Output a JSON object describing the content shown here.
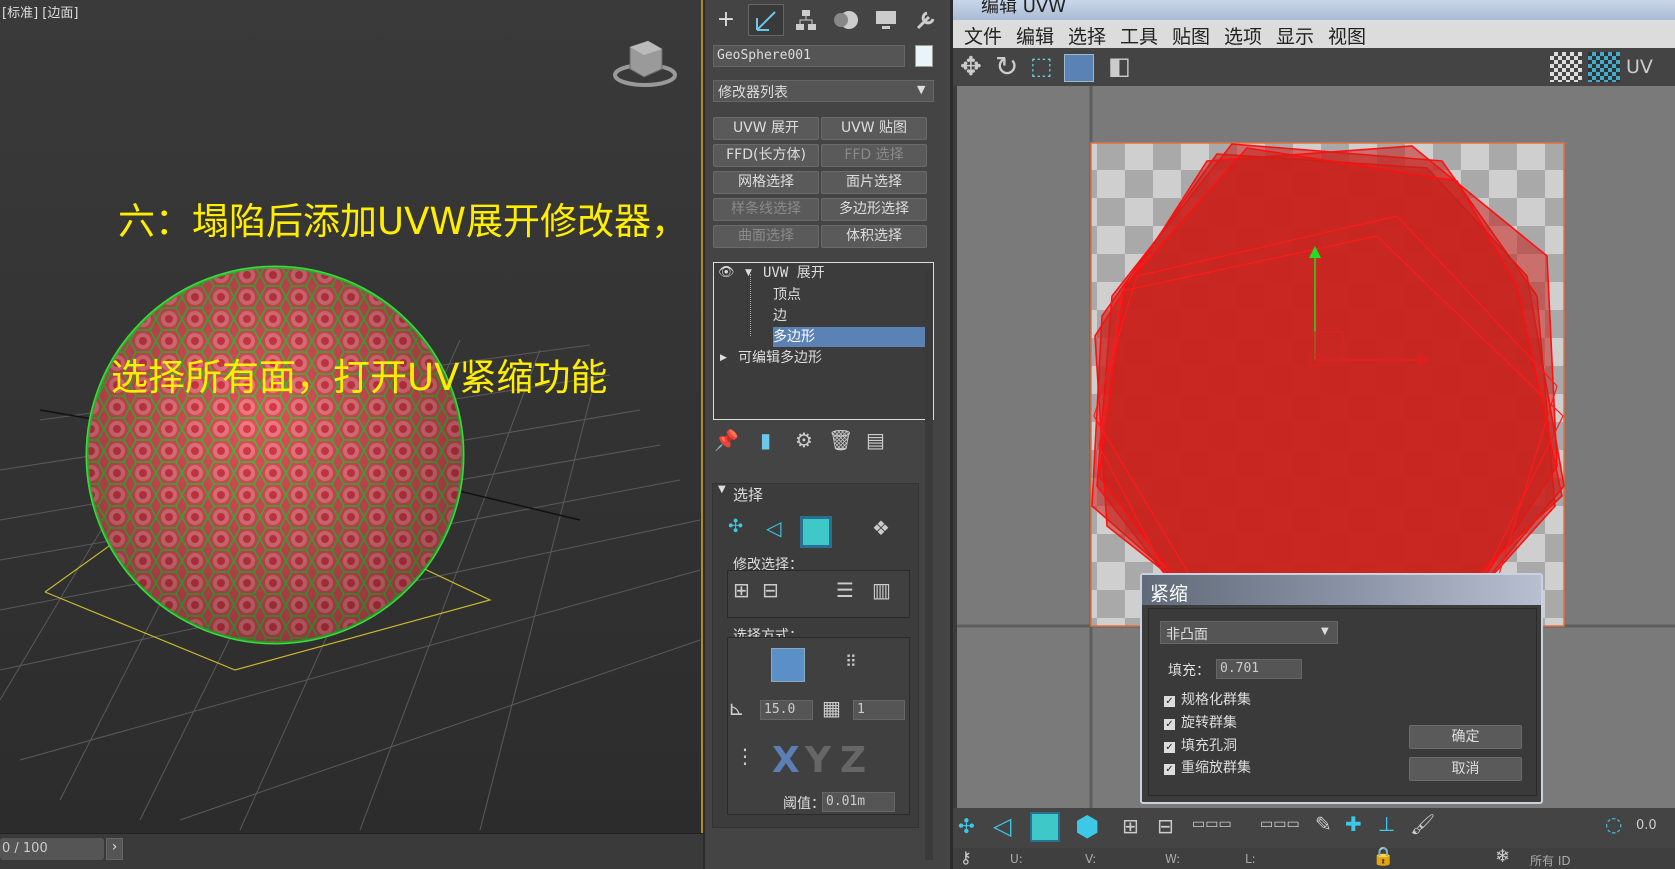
{
  "viewport": {
    "label": "[标准] [边面]",
    "tutorial_line1": "六：塌陷后添加UVW展开修改器，",
    "tutorial_line2": "选择所有面，打开UV紧缩功能",
    "frame": "0 / 100",
    "next_arrow": "›",
    "axis_z": "Z"
  },
  "command_panel": {
    "tabs": [
      "create-icon",
      "modify-icon",
      "hierarchy-icon",
      "motion-icon",
      "display-icon",
      "utilities-icon"
    ],
    "object_name": "GeoSphere001",
    "object_color": "#e8f4f8",
    "modifier_list": "修改器列表",
    "modifier_buttons": [
      {
        "label": "UVW 展开",
        "enabled": true
      },
      {
        "label": "UVW 贴图",
        "enabled": true
      },
      {
        "label": "FFD(长方体)",
        "enabled": true
      },
      {
        "label": "FFD 选择",
        "enabled": false
      },
      {
        "label": "网格选择",
        "enabled": true
      },
      {
        "label": "面片选择",
        "enabled": true
      },
      {
        "label": "样条线选择",
        "enabled": false
      },
      {
        "label": "多边形选择",
        "enabled": true
      },
      {
        "label": "曲面选择",
        "enabled": false
      },
      {
        "label": "体积选择",
        "enabled": true
      }
    ],
    "stack": {
      "top": "UVW 展开",
      "sub_vertex": "顶点",
      "sub_edge": "边",
      "sub_polygon": "多边形",
      "base": "可编辑多边形"
    },
    "selection_rollout": {
      "title": "选择",
      "modify_selection": "修改选择：",
      "select_by": "选择方式：",
      "angle_value": "15.0",
      "count_value": "1",
      "threshold_label": "阈值：",
      "threshold_value": "0.01m",
      "x_label": "X",
      "y_label": "Y",
      "z_label": "Z"
    }
  },
  "uvw_editor": {
    "title": "编辑 UVW",
    "menu": [
      "文件",
      "编辑",
      "选择",
      "工具",
      "贴图",
      "选项",
      "显示",
      "视图"
    ],
    "uv_label": "UV",
    "bottom_value": "0.0",
    "bottom_fields": [
      "U:",
      "V:",
      "W:",
      "L:"
    ],
    "bottom_all_ids": "所有 ID"
  },
  "pack_dialog": {
    "title": "紧缩",
    "mode": "非凸面",
    "padding_label": "填充：",
    "padding_value": "0.701",
    "options": [
      {
        "label": "规格化群集",
        "checked": true
      },
      {
        "label": "旋转群集",
        "checked": true
      },
      {
        "label": "填充孔洞",
        "checked": true
      },
      {
        "label": "重缩放群集",
        "checked": true
      }
    ],
    "ok": "确定",
    "cancel": "取消"
  }
}
